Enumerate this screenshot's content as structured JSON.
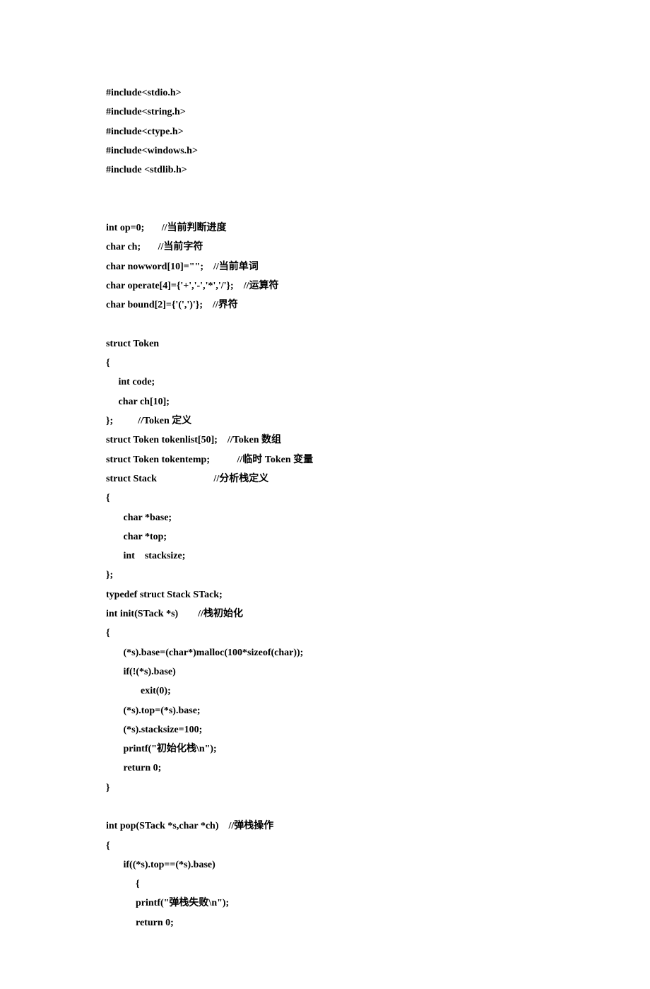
{
  "lines": [
    "#include<stdio.h>",
    "#include<string.h>",
    "#include<ctype.h>",
    "#include<windows.h>",
    "#include <stdlib.h>",
    "",
    "",
    "int op=0;       //当前判断进度",
    "char ch;       //当前字符",
    "char nowword[10]=\"\";    //当前单词",
    "char operate[4]={'+','-','*','/'};    //运算符",
    "char bound[2]={'(',')'};    //界符",
    "",
    "struct Token",
    "{",
    "     int code;",
    "     char ch[10];",
    "};          //Token 定义",
    "struct Token tokenlist[50];    //Token 数组",
    "struct Token tokentemp;           //临时 Token 变量",
    "struct Stack                       //分析栈定义",
    "{",
    "       char *base;",
    "       char *top;",
    "       int    stacksize;",
    "};",
    "typedef struct Stack STack;",
    "int init(STack *s)        //栈初始化",
    "{",
    "       (*s).base=(char*)malloc(100*sizeof(char));",
    "       if(!(*s).base)",
    "              exit(0);",
    "       (*s).top=(*s).base;",
    "       (*s).stacksize=100;",
    "       printf(\"初始化栈\\n\");",
    "       return 0;",
    "}",
    "",
    "int pop(STack *s,char *ch)    //弹栈操作",
    "{",
    "       if((*s).top==(*s).base)",
    "            {",
    "            printf(\"弹栈失败\\n\");",
    "            return 0;"
  ]
}
